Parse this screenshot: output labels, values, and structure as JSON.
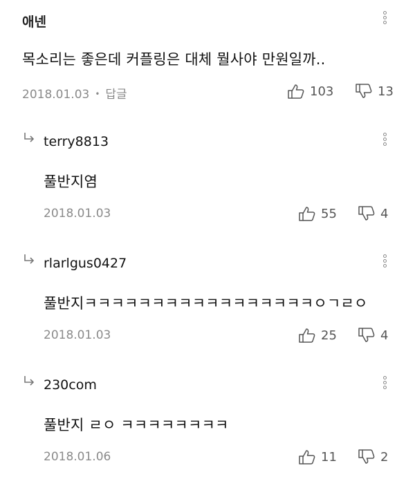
{
  "comments": [
    {
      "author": "애넨",
      "text": "목소리는 좋은데 커플링은 대체 뭘사야 만원일까..",
      "date": "2018.01.03",
      "reply_label": "답글",
      "likes": "103",
      "dislikes": "13"
    },
    {
      "author": "terry8813",
      "text": "풀반지염",
      "date": "2018.01.03",
      "likes": "55",
      "dislikes": "4"
    },
    {
      "author": "rlarlgus0427",
      "text": "풀반지ㅋㅋㅋㅋㅋㅋㅋㅋㅋㅋㅋㅋㅋㅋㅋㅋㅋㅇㄱㄹㅇ",
      "date": "2018.01.03",
      "likes": "25",
      "dislikes": "4"
    },
    {
      "author": "230com",
      "text": "풀반지 ㄹㅇ ㅋㅋㅋㅋㅋㅋㅋㅋ",
      "date": "2018.01.06",
      "likes": "11",
      "dislikes": "2"
    }
  ],
  "icons": {
    "more": "more-vertical-icon",
    "reply": "reply-arrow-icon",
    "like": "thumbs-up-icon",
    "dislike": "thumbs-down-icon"
  }
}
